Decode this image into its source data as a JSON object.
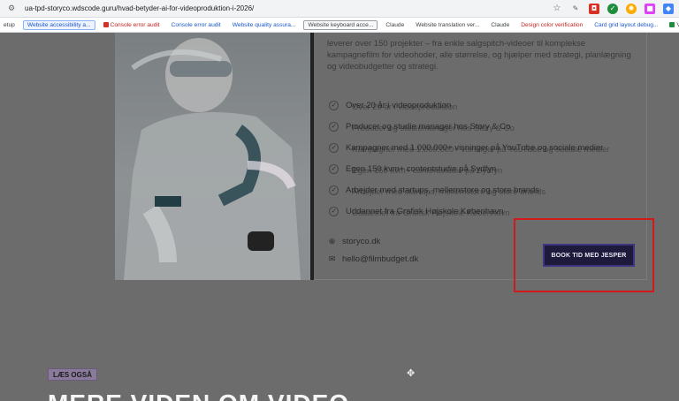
{
  "browser": {
    "url": "ua-tpd-storyco.wdscode.guru/hvad-betyder-ai-for-videoproduktion-i-2026/",
    "bookmarks": [
      {
        "label": "etup",
        "style": "plain"
      },
      {
        "label": "Website accessibility a...",
        "style": "blue"
      },
      {
        "label": "Console error audit",
        "style": "redtext",
        "dot": "#d93025"
      },
      {
        "label": "Console error audit",
        "style": "plain-blue"
      },
      {
        "label": "Website quality assura...",
        "style": "plain-blue"
      },
      {
        "label": "Website keyboard acce...",
        "style": "gray"
      },
      {
        "label": "Claude",
        "style": "plain"
      },
      {
        "label": "Website translation ver...",
        "style": "plain"
      },
      {
        "label": "Claude",
        "style": "plain"
      },
      {
        "label": "Design color verification",
        "style": "redtext"
      },
      {
        "label": "Card grid layout debug...",
        "style": "plain-blue"
      },
      {
        "label": "Verify website styl",
        "style": "plain",
        "dot": "#1e8e3e"
      }
    ]
  },
  "intro": {
    "text": "leverer over 150 projekter – fra enkle salgspitch-videoer til komplekse kampagnefilm for videohoder, alle størrelse, og hjælper med strategi, planlægning og videobudgetter og strategi."
  },
  "features": [
    {
      "text": "Over 20 år i videoproduktion",
      "ghost": "Over 20 år i videoproduktion"
    },
    {
      "text": "Producer og studie manager hos Story & Co",
      "ghost": "Producer og studiemanager hos Story & Co"
    },
    {
      "text": "Kampagner med 1.000.000+ visninger på YouTube og sociale medier",
      "ghost": "Kampagner med 1.000.000+ visninger på YouTube og sociale medier"
    },
    {
      "text": "Egen 150 kvm+ contentstudie på Sydfyn",
      "ghost": "Egen 150 kvm+ contentstudie på Sydfyn"
    },
    {
      "text": "Arbejder med startups, mellemstore og store brands",
      "ghost": "Arbejder med startups, mellemstore og store brands"
    },
    {
      "text": "Uddannet fra Grafisk Højskole København",
      "ghost": "Uddannet fra Grafisk Højskole København"
    }
  ],
  "contact": {
    "website": "storyco.dk",
    "email": "hello@filmbudget.dk"
  },
  "cta": {
    "book_label": "BOOK TID MED JESPER"
  },
  "more": {
    "tag": "LÆS OGSÅ",
    "heading": "MERE VIDEN OM VIDEO"
  },
  "colors": {
    "page_bg": "#6c6c6c",
    "cta_bg": "#1d1a3b",
    "highlight": "#d11b1b"
  }
}
